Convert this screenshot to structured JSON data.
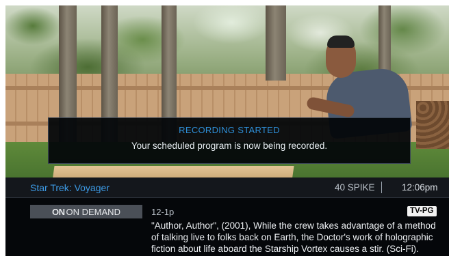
{
  "notification": {
    "title": "RECORDING STARTED",
    "message": "Your scheduled program is now being recorded."
  },
  "info_bar": {
    "program_title": "Star Trek: Voyager",
    "channel": "40 SPIKE",
    "time": "12:06pm"
  },
  "on_demand": {
    "logo_text": "ON",
    "label": "ON DEMAND"
  },
  "program": {
    "airtime": "12-1p",
    "rating": "TV-PG",
    "description": "\"Author, Author\", (2001), While the crew takes advantage of a method of talking live to folks back on Earth, the Doctor's work of holographic fiction about life aboard the Starship Vortex causes a stir. (Sci-Fi)."
  },
  "colors": {
    "accent_blue": "#3d9be6",
    "notice_title_blue": "#2e8fd8",
    "banner_bg": "#05070a"
  }
}
